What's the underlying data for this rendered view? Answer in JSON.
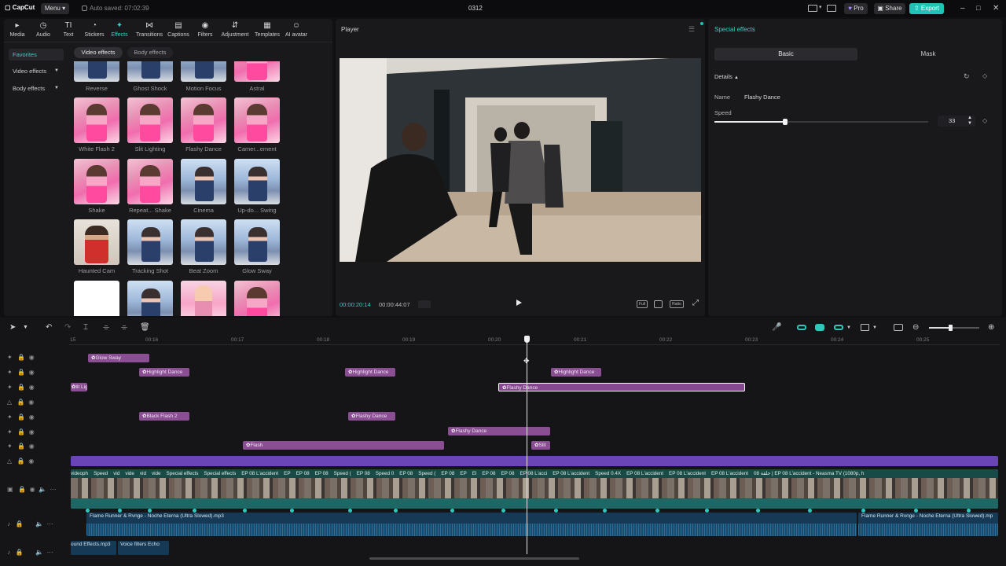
{
  "titlebar": {
    "app_name": "CapCut",
    "menu_label": "Menu",
    "autosave_text": "Auto saved: 07:02:39",
    "project_title": "0312",
    "pro_label": "Pro",
    "share_label": "Share",
    "export_label": "Export",
    "accent": "#1ec3b6"
  },
  "toolbar": {
    "items": [
      {
        "label": "Media",
        "icon": "media-icon"
      },
      {
        "label": "Audio",
        "icon": "audio-icon"
      },
      {
        "label": "Text",
        "icon": "text-icon"
      },
      {
        "label": "Stickers",
        "icon": "stickers-icon"
      },
      {
        "label": "Effects",
        "icon": "effects-icon"
      },
      {
        "label": "Transitions",
        "icon": "transitions-icon"
      },
      {
        "label": "Captions",
        "icon": "captions-icon"
      },
      {
        "label": "Filters",
        "icon": "filters-icon"
      },
      {
        "label": "Adjustment",
        "icon": "adjustment-icon"
      },
      {
        "label": "Templates",
        "icon": "templates-icon"
      },
      {
        "label": "AI avatar",
        "icon": "ai-avatar-icon"
      }
    ]
  },
  "sidebar": {
    "favorites": "Favorites",
    "video_effects": "Video effects",
    "body_effects": "Body effects"
  },
  "chips": {
    "video_effects": "Video effects",
    "body_effects": "Body effects"
  },
  "effects_grid": {
    "row0": [
      "Reverse",
      "Ghost Shock",
      "Motion Focus",
      "Astral"
    ],
    "row1": [
      "White Flash 2",
      "Slit Lighting",
      "Flashy Dance",
      "Camer...ement"
    ],
    "row2": [
      "Shake",
      "Repeat... Shake",
      "Cinema",
      "Up-do... Swing"
    ],
    "row3": [
      "Haunted Cam",
      "Tracking Shot",
      "Beat Zoom",
      "Glow Sway"
    ]
  },
  "player": {
    "title": "Player",
    "current_time": "00:00:20:14",
    "total_time": "00:00:44:07",
    "full_label": "Full",
    "ratio_label": "Ratio"
  },
  "details_panel": {
    "title": "Special effects",
    "tab_basic": "Basic",
    "tab_mask": "Mask",
    "details_label": "Details",
    "name_label": "Name",
    "name_value": "Flashy Dance",
    "speed_label": "Speed",
    "speed_value": "33",
    "speed_fraction": 0.33
  },
  "ruler": {
    "labels": [
      "15",
      "00:16",
      "00:17",
      "00:18",
      "00:19",
      "00:20",
      "00:21",
      "00:22",
      "00:23",
      "00:24",
      "00:25"
    ]
  },
  "tracks": {
    "effect_clips": [
      {
        "label": "Glow Sway"
      },
      {
        "label": "Highlight Dance"
      },
      {
        "label": "Highlight Dance"
      },
      {
        "label": "Highlight Dance"
      },
      {
        "label": "lit Ligh"
      },
      {
        "label": "Flashy Dance"
      },
      {
        "label": "Black Flash 2"
      },
      {
        "label": "Flashy Dance"
      },
      {
        "label": "Flashy Dance"
      },
      {
        "label": "Flash"
      },
      {
        "label": "Slit"
      }
    ],
    "video_labels": [
      "videoph",
      "Speed",
      "vid",
      "vide",
      "vid",
      "vide",
      "Special effects",
      "Special effects",
      "EP 08 L'accident",
      "EP",
      "EP 08",
      "EP 08",
      "Speed (",
      "EP 08",
      "Speed 0",
      "EP 08",
      "Speed (",
      "EP 08",
      "EP",
      "El",
      "EP 08",
      "EP 08",
      "EP 08 L'acci",
      "EP 08 L'accident",
      "Speed 0.4X",
      "EP 08 L'accident",
      "EP 08 L'accident",
      "EP 08 L'accident",
      "حلقة 08 | EP 08 L'accident - Neasma TV (1080p, h"
    ],
    "audio1_label": "Flame Runner & Rvnge - Noche Eterna (Ultra Slowed).mp3",
    "audio1_label_b": "Flame Runner & Rvnge - Noche Eterna (Ultra Slowed).mp",
    "audio2_label": "ound Effects.mp3",
    "audio2_label_b": "Voice filters Echo"
  }
}
